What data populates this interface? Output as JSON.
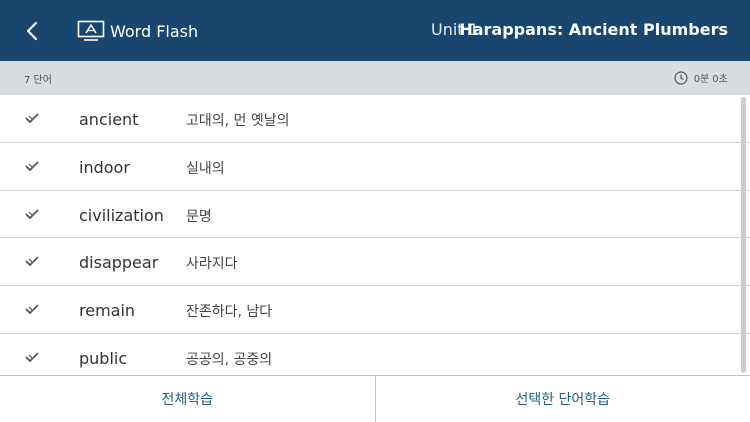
{
  "header": {
    "app_title": "Word Flash",
    "unit": "Unit 1",
    "lesson_title": "Harappans: Ancient Plumbers"
  },
  "subbar": {
    "word_count": "7 단어",
    "timer": "0분 0초"
  },
  "words": [
    {
      "word": "ancient",
      "meaning": "고대의, 먼 옛날의"
    },
    {
      "word": "indoor",
      "meaning": "실내의"
    },
    {
      "word": "civilization",
      "meaning": "문명"
    },
    {
      "word": "disappear",
      "meaning": "사라지다"
    },
    {
      "word": "remain",
      "meaning": "잔존하다, 남다"
    },
    {
      "word": "public",
      "meaning": "공공의, 공중의"
    }
  ],
  "bottom": {
    "study_all": "전체학습",
    "study_selected": "선택한 단어학습"
  },
  "colors": {
    "header_bg": "#19466e",
    "subbar_bg": "#d9dde0",
    "accent": "#1f5f86"
  },
  "icons": {
    "back": "chevron-left-icon",
    "app": "flashcard-screen-icon",
    "timer": "clock-icon",
    "check": "checkmark-icon"
  }
}
